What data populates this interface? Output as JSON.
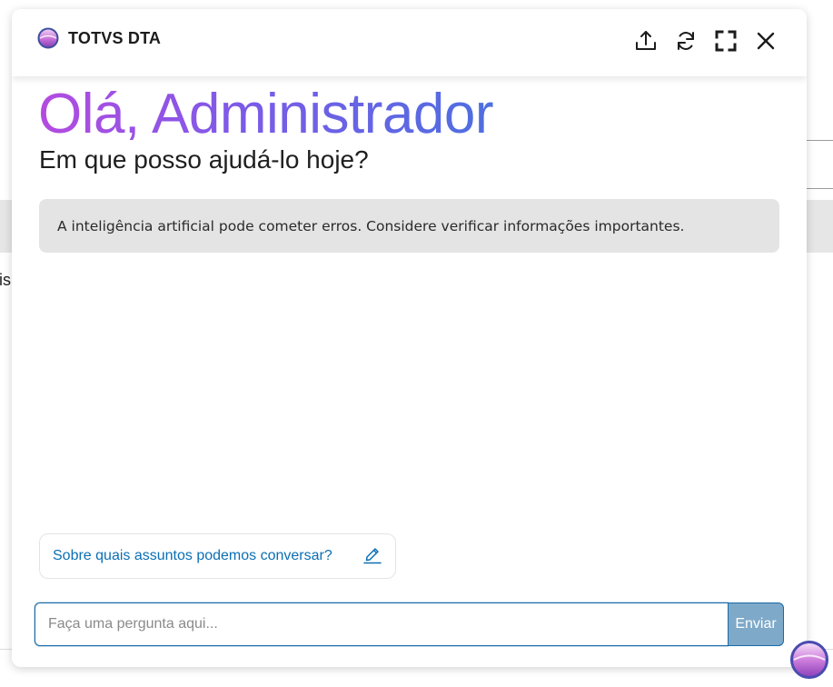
{
  "background": {
    "partial_text": "is"
  },
  "header": {
    "brand_name": "TOTVS DTA",
    "actions": [
      {
        "id": "export",
        "icon": "upload-icon"
      },
      {
        "id": "refresh",
        "icon": "refresh-icon"
      },
      {
        "id": "fullscreen",
        "icon": "fullscreen-icon"
      },
      {
        "id": "close",
        "icon": "close-icon"
      }
    ]
  },
  "main": {
    "greeting": "Olá, Administrador",
    "subtitle": "Em que posso ajudá-lo hoje?",
    "disclaimer": "A inteligência artificial pode cometer erros. Considere verificar informações importantes."
  },
  "suggestion": {
    "label": "Sobre quais assuntos podemos conversar?",
    "icon": "pencil-icon"
  },
  "composer": {
    "placeholder": "Faça uma pergunta aqui...",
    "value": "",
    "send_label": "Enviar"
  },
  "colors": {
    "accent_blue": "#0b6fb3",
    "input_border": "#1a6aa8",
    "send_disabled": "#7ea9c9",
    "gradient_start": "#b44be0",
    "gradient_end": "#4d6fe0",
    "disclaimer_bg": "#e4e4e4"
  }
}
